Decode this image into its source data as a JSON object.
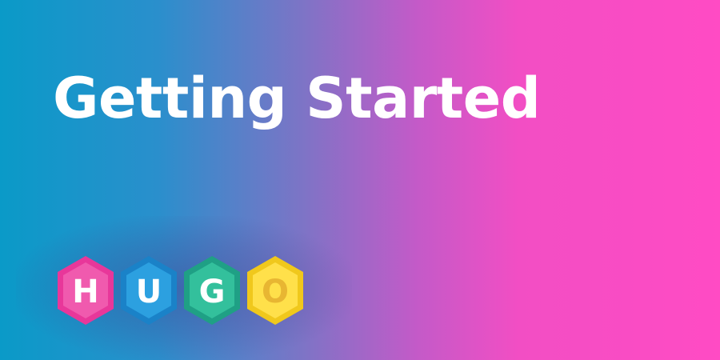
{
  "banner": {
    "title": "Getting Started"
  },
  "logo": {
    "name": "HUGO",
    "letters": [
      {
        "char": "H",
        "outer": "#e8379a",
        "inner": "#f05aae",
        "text": "#ffffff"
      },
      {
        "char": "U",
        "outer": "#1a82c8",
        "inner": "#2ca0e0",
        "text": "#ffffff"
      },
      {
        "char": "G",
        "outer": "#1fa085",
        "inner": "#33c09c",
        "text": "#ffffff"
      },
      {
        "char": "O",
        "outer": "#f0c81c",
        "inner": "#ffe04a",
        "text": "#e8b632"
      }
    ]
  },
  "colors": {
    "gradient_start": "#0a9ac8",
    "gradient_end": "#ff4bc4",
    "title": "#ffffff"
  }
}
